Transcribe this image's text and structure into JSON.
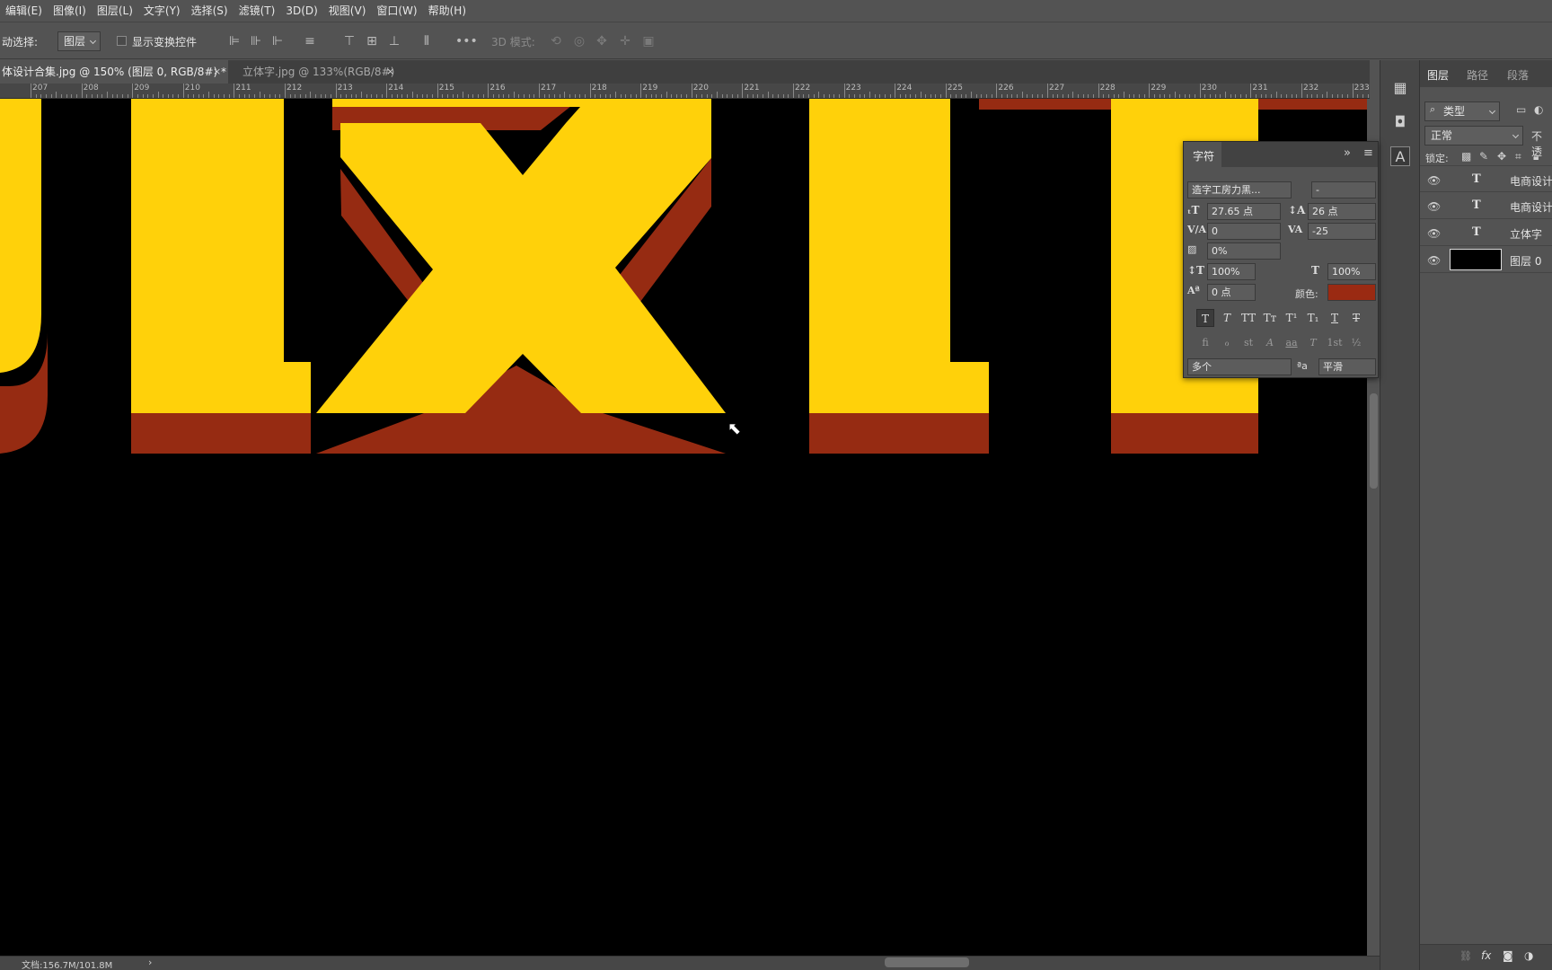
{
  "menu": [
    "编辑(E)",
    "图像(I)",
    "图层(L)",
    "文字(Y)",
    "选择(S)",
    "滤镜(T)",
    "3D(D)",
    "视图(V)",
    "窗口(W)",
    "帮助(H)"
  ],
  "options": {
    "auto_select_label": "动选择:",
    "auto_select_value": "图层",
    "show_transform_label": "显示变换控件",
    "more": "•••",
    "mode_3d_label": "3D 模式:"
  },
  "tabs": [
    {
      "label": "体设计合集.jpg @ 150% (图层 0, RGB/8#) *",
      "close": "×"
    },
    {
      "label": "立体字.jpg @ 133%(RGB/8#)",
      "close": "×"
    }
  ],
  "ruler": [
    "207",
    "208",
    "209",
    "210",
    "211",
    "212",
    "213",
    "214",
    "215",
    "216",
    "217",
    "218",
    "219",
    "220",
    "221",
    "222",
    "223",
    "224",
    "225",
    "226",
    "227",
    "228",
    "229",
    "230",
    "231",
    "232",
    "233"
  ],
  "status": {
    "doc": "文档:156.7M/101.8M",
    "arrow": "›"
  },
  "artwork": {
    "letter_color": "#FFD10A",
    "shadow_color": "#962B12",
    "background": "#000000"
  },
  "layers_panel": {
    "tabs": [
      "图层",
      "路径",
      "段落"
    ],
    "filter": "类型",
    "blend_mode": "正常",
    "opacity_label": "不透",
    "lock_label": "锁定:",
    "layers": [
      {
        "name": "电商设计",
        "type": "text"
      },
      {
        "name": "电商设计",
        "type": "text"
      },
      {
        "name": "立体字",
        "type": "text"
      },
      {
        "name": "图层 0",
        "type": "image"
      }
    ],
    "footer_icons": [
      "link-icon",
      "fx-icon",
      "mask-icon",
      "adjustment-icon"
    ],
    "fx_label": "fx"
  },
  "character_panel": {
    "title": "字符",
    "font_family": "造字工房力黑...",
    "font_style": "-",
    "font_size": "27.65 点",
    "leading": "26 点",
    "kerning": "0",
    "tracking": "-25",
    "scale_percent": "0%",
    "vertical_scale": "100%",
    "horizontal_scale": "100%",
    "baseline_shift": "0 点",
    "color_label": "颜色:",
    "color_value": "#9A2A12",
    "language": "多个",
    "antialias": "平滑",
    "aa_label": "ªa",
    "style_buttons": [
      "T",
      "T",
      "TT",
      "Tт",
      "T¹",
      "T₁",
      "T",
      "T"
    ],
    "feature_buttons": [
      "fi",
      "ℴ",
      "st",
      "A",
      "aa",
      "T",
      "1st",
      "½"
    ]
  }
}
